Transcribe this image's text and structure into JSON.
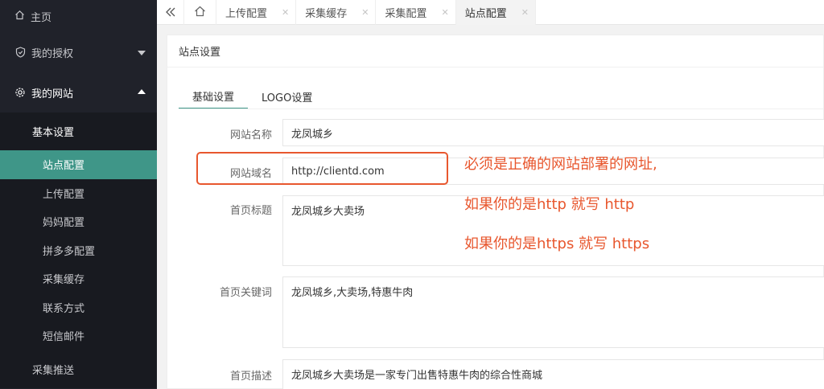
{
  "sidebar": {
    "home": "主页",
    "items": [
      {
        "label": "我的授权",
        "icon": "shield-icon"
      },
      {
        "label": "我的网站",
        "icon": "gear-icon"
      }
    ],
    "submenu_head": "基本设置",
    "submenu_items": [
      "站点配置",
      "上传配置",
      "妈妈配置",
      "拼多多配置",
      "采集缓存",
      "联系方式",
      "短信邮件"
    ],
    "active_item": "站点配置",
    "bottom_item": "采集推送",
    "colors": {
      "bg": "#20222a",
      "sub_bg": "#181a20",
      "active": "#3f9688"
    }
  },
  "topbar": {
    "tabs": [
      {
        "label": "上传配置",
        "active": false
      },
      {
        "label": "采集缓存",
        "active": false
      },
      {
        "label": "采集配置",
        "active": false
      },
      {
        "label": "站点配置",
        "active": true
      }
    ]
  },
  "card": {
    "title": "站点设置",
    "tabs": [
      "基础设置",
      "LOGO设置"
    ],
    "active_tab": "基础设置",
    "fields": [
      {
        "label": "网站名称",
        "value": "龙凤城乡"
      },
      {
        "label": "网站域名",
        "value": "http://clientd.com"
      },
      {
        "label": "首页标题",
        "value": "龙凤城乡大卖场"
      },
      {
        "label": "首页关键词",
        "value": "龙凤城乡,大卖场,特惠牛肉"
      },
      {
        "label": "首页描述",
        "value": "龙凤城乡大卖场是一家专门出售特惠牛肉的综合性商城"
      }
    ]
  },
  "annotation": {
    "color": "#e8572e",
    "lines": [
      "必须是正确的网站部署的网址,",
      "如果你的是http  就写 http",
      "如果你的是https 就写 https"
    ]
  }
}
